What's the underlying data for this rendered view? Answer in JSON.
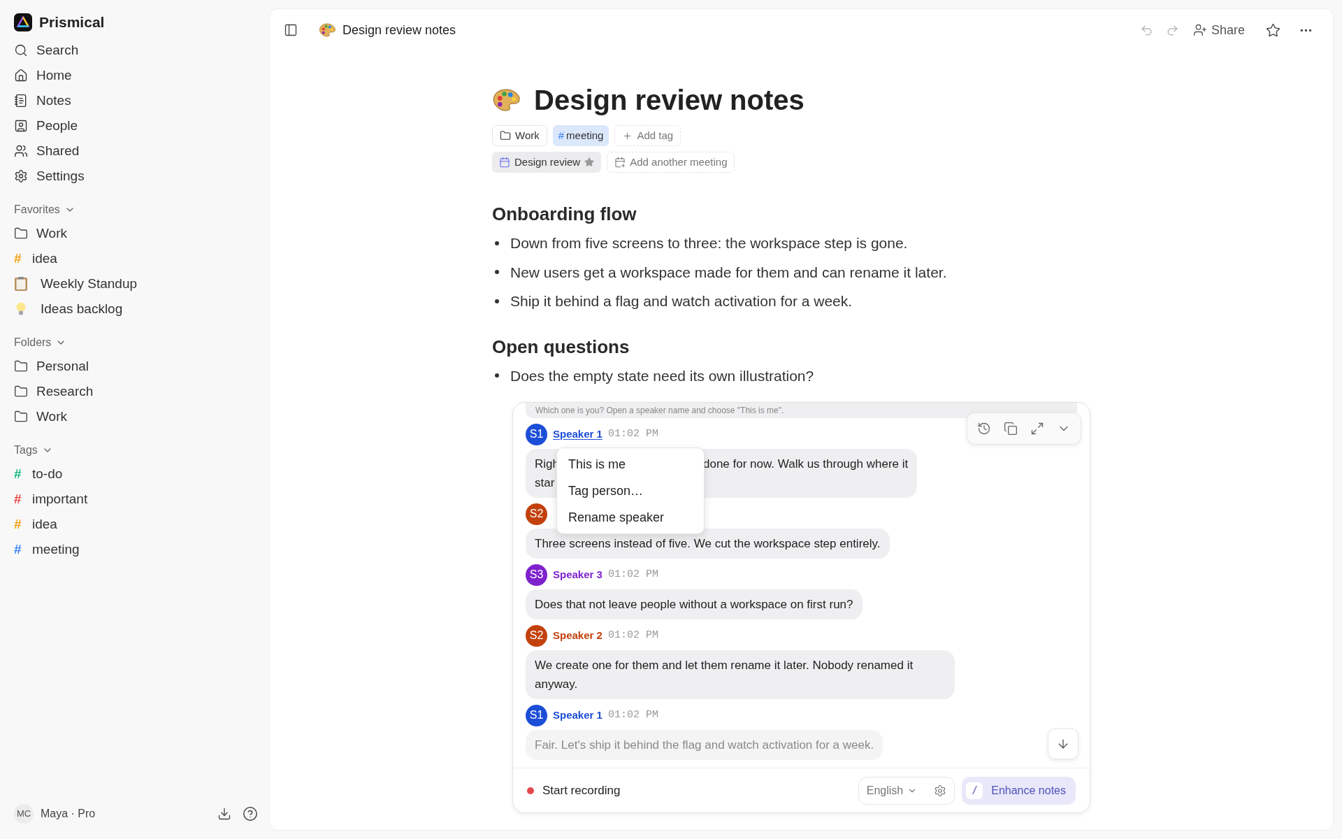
{
  "app": {
    "name": "Prismical"
  },
  "nav": [
    {
      "kind": "search",
      "label": "Search"
    },
    {
      "kind": "home",
      "label": "Home"
    },
    {
      "kind": "notes",
      "label": "Notes"
    },
    {
      "kind": "people",
      "label": "People"
    },
    {
      "kind": "shared",
      "label": "Shared"
    },
    {
      "kind": "settings",
      "label": "Settings"
    }
  ],
  "sections": [
    {
      "title": "Favorites",
      "items": [
        {
          "kind": "folder",
          "label": "Work"
        },
        {
          "kind": "tag",
          "mark": "#",
          "label": "idea",
          "color": "#f59e0b"
        },
        {
          "kind": "clipboard",
          "label": "Weekly Standup"
        },
        {
          "kind": "bulb",
          "label": "Ideas backlog"
        }
      ]
    },
    {
      "title": "Folders",
      "items": [
        {
          "kind": "folder",
          "label": "Personal"
        },
        {
          "kind": "folder",
          "label": "Research"
        },
        {
          "kind": "folder",
          "label": "Work"
        }
      ]
    },
    {
      "title": "Tags",
      "items": [
        {
          "kind": "tag",
          "mark": "#",
          "label": "to-do",
          "color": "#10b981"
        },
        {
          "kind": "tag",
          "mark": "#",
          "label": "important",
          "color": "#ef4444"
        },
        {
          "kind": "tag",
          "mark": "#",
          "label": "idea",
          "color": "#f59e0b"
        },
        {
          "kind": "tag",
          "mark": "#",
          "label": "meeting",
          "color": "#3b82f6"
        }
      ]
    }
  ],
  "user": {
    "initials": "MC",
    "name": "Maya · Pro"
  },
  "header": {
    "title": "Design review notes",
    "share": "Share"
  },
  "doc": {
    "title": "Design review notes",
    "chips": [
      {
        "kind": "folder",
        "label": "Work"
      },
      {
        "kind": "tag",
        "mark": "#",
        "label": "meeting"
      },
      {
        "kind": "add",
        "label": "Add tag"
      }
    ],
    "meetings": [
      {
        "kind": "meeting",
        "label": "Design review"
      },
      {
        "kind": "add",
        "label": "Add another meeting"
      }
    ],
    "sections": [
      {
        "heading": "Onboarding flow",
        "bullets": [
          "Down from five screens to three: the workspace step is gone.",
          "New users get a workspace made for them and can rename it later.",
          "Ship it behind a flag and watch activation for a week."
        ]
      },
      {
        "heading": "Open questions",
        "bullets": [
          "Does the empty state need its own illustration?"
        ]
      }
    ]
  },
  "transcript": {
    "banner": "Which one is you? Open a speaker name and choose \"This is me\".",
    "messages": [
      {
        "avatar": "S1",
        "speaker": "Speaker 1",
        "time": "01:02 PM",
        "color": "#1d4ed8",
        "selected": true,
        "faded": false,
        "lines": [
          [
            "Righ",
            "done for now. Walk us through where it"
          ],
          [
            "star"
          ]
        ]
      },
      {
        "avatar": "S2",
        "color": "#c2410c",
        "faded": false,
        "lines": [
          [
            "Three screens instead of five. We cut the workspace step entirely."
          ]
        ]
      },
      {
        "avatar": "S3",
        "speaker": "Speaker 3",
        "time": "01:02 PM",
        "color": "#7e22ce",
        "selected": false,
        "faded": false,
        "lines": [
          [
            "Does that not leave people without a workspace on first run?"
          ]
        ]
      },
      {
        "avatar": "S2",
        "speaker": "Speaker 2",
        "time": "01:02 PM",
        "color": "#c2410c",
        "selected": false,
        "faded": false,
        "lines": [
          [
            "We create one for them and let them rename it later. Nobody renamed it anyway."
          ]
        ]
      },
      {
        "avatar": "S1",
        "speaker": "Speaker 1",
        "time": "01:02 PM",
        "color": "#1d4ed8",
        "selected": false,
        "faded": true,
        "lines": [
          [
            "Fair. Let's ship it behind the flag and watch activation for a week."
          ]
        ]
      }
    ],
    "menu": [
      "This is me",
      "Tag person…",
      "Rename speaker"
    ],
    "record": "Start recording",
    "language": "English",
    "enhance_key": "/",
    "enhance": "Enhance notes"
  }
}
